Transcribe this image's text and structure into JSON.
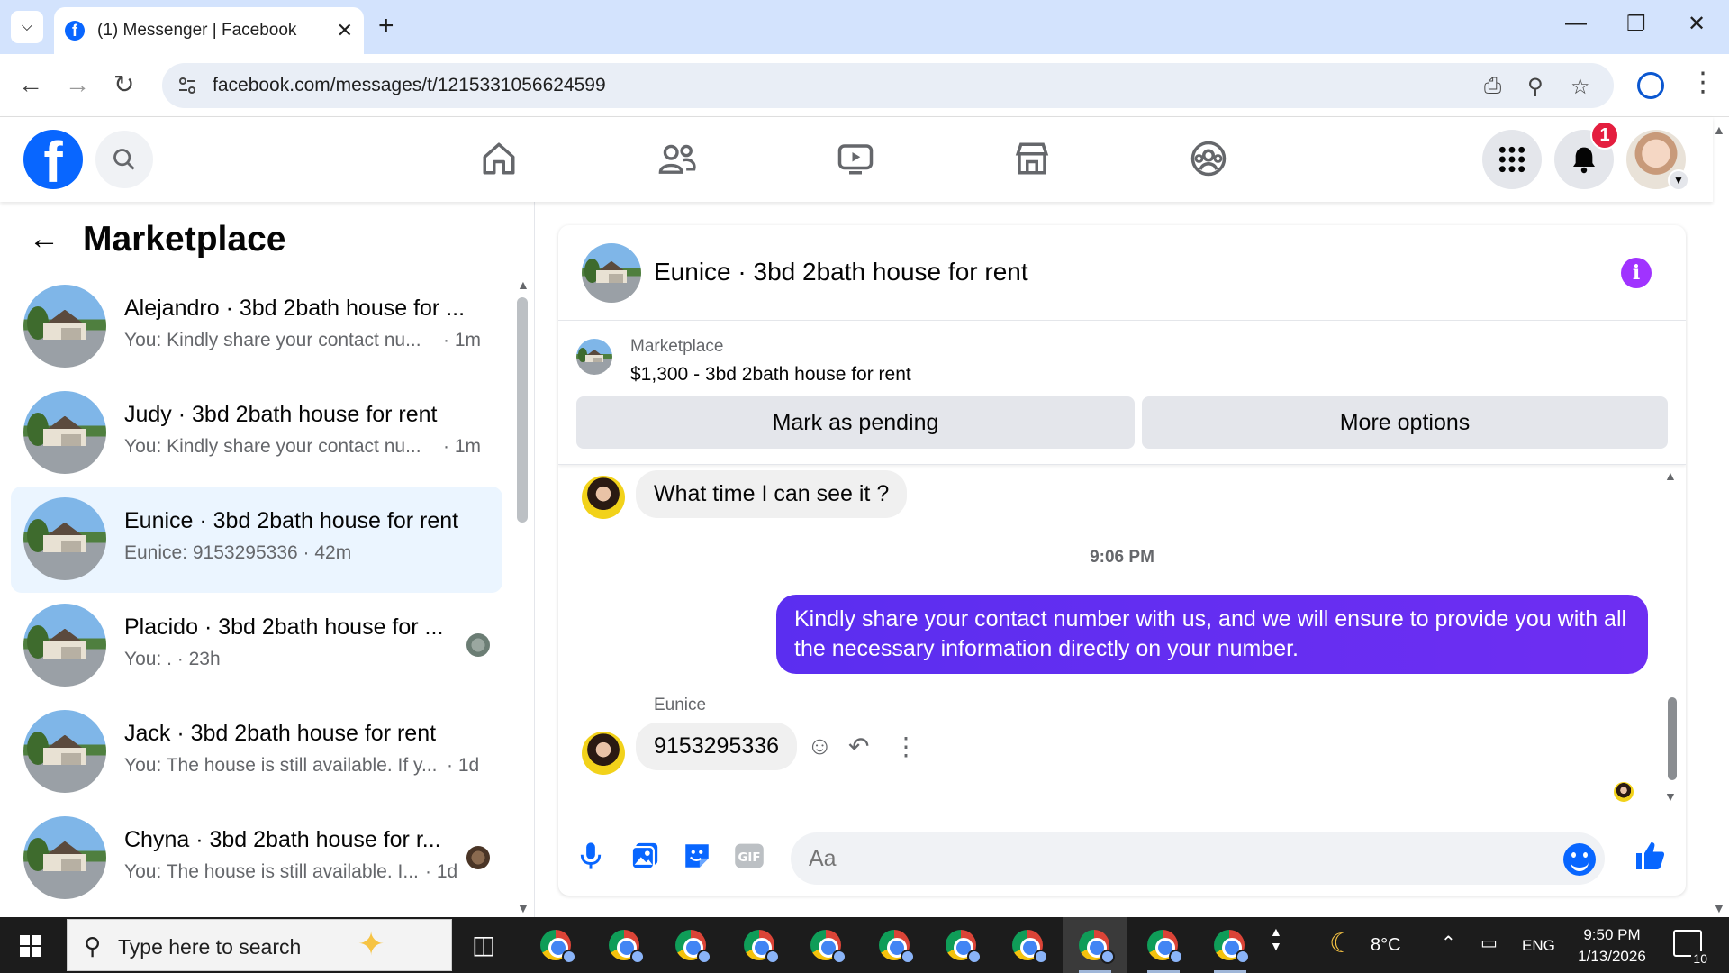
{
  "browser": {
    "tab_title": "(1) Messenger | Facebook",
    "url": "facebook.com/messages/t/1215331056624599"
  },
  "fb": {
    "notification_count": "1"
  },
  "left": {
    "title": "Marketplace",
    "conversations": [
      {
        "name": "Alejandro · 3bd 2bath house for ...",
        "preview": "You: Kindly share your contact nu...",
        "time": "· 1m"
      },
      {
        "name": "Judy · 3bd 2bath house for rent",
        "preview": "You: Kindly share your contact nu...",
        "time": "· 1m"
      },
      {
        "name": "Eunice · 3bd 2bath house for rent",
        "preview": "Eunice: 9153295336 · 42m",
        "time": ""
      },
      {
        "name": "Placido · 3bd 2bath house for ...",
        "preview": "You: . · 23h",
        "time": ""
      },
      {
        "name": "Jack · 3bd 2bath house for rent",
        "preview": "You: The house is still available. If y...",
        "time": "· 1d"
      },
      {
        "name": "Chyna · 3bd 2bath house for r...",
        "preview": "You: The house is still available. I...",
        "time": "· 1d"
      }
    ]
  },
  "chat": {
    "title": "Eunice · 3bd 2bath house for rent",
    "listing_label": "Marketplace",
    "listing_price": "$1,300 - 3bd 2bath house for rent",
    "mark_pending": "Mark as pending",
    "more_options": "More options",
    "msg1": "What time I can see it ?",
    "timestamp": "9:06 PM",
    "msg2": "Kindly share your contact number with us, and we will ensure to provide you with all the necessary information directly on your number.",
    "sender": "Eunice",
    "msg3": "9153295336",
    "input_placeholder": "Aa"
  },
  "taskbar": {
    "search_placeholder": "Type here to search",
    "weather": "8°C",
    "lang": "ENG",
    "time": "9:50 PM",
    "date": "1/13/2026",
    "notifications": "10"
  },
  "colors": {
    "fb_blue": "#0866ff",
    "bubble_out": "#6a2ef0",
    "active_conv": "#ebf5ff"
  }
}
